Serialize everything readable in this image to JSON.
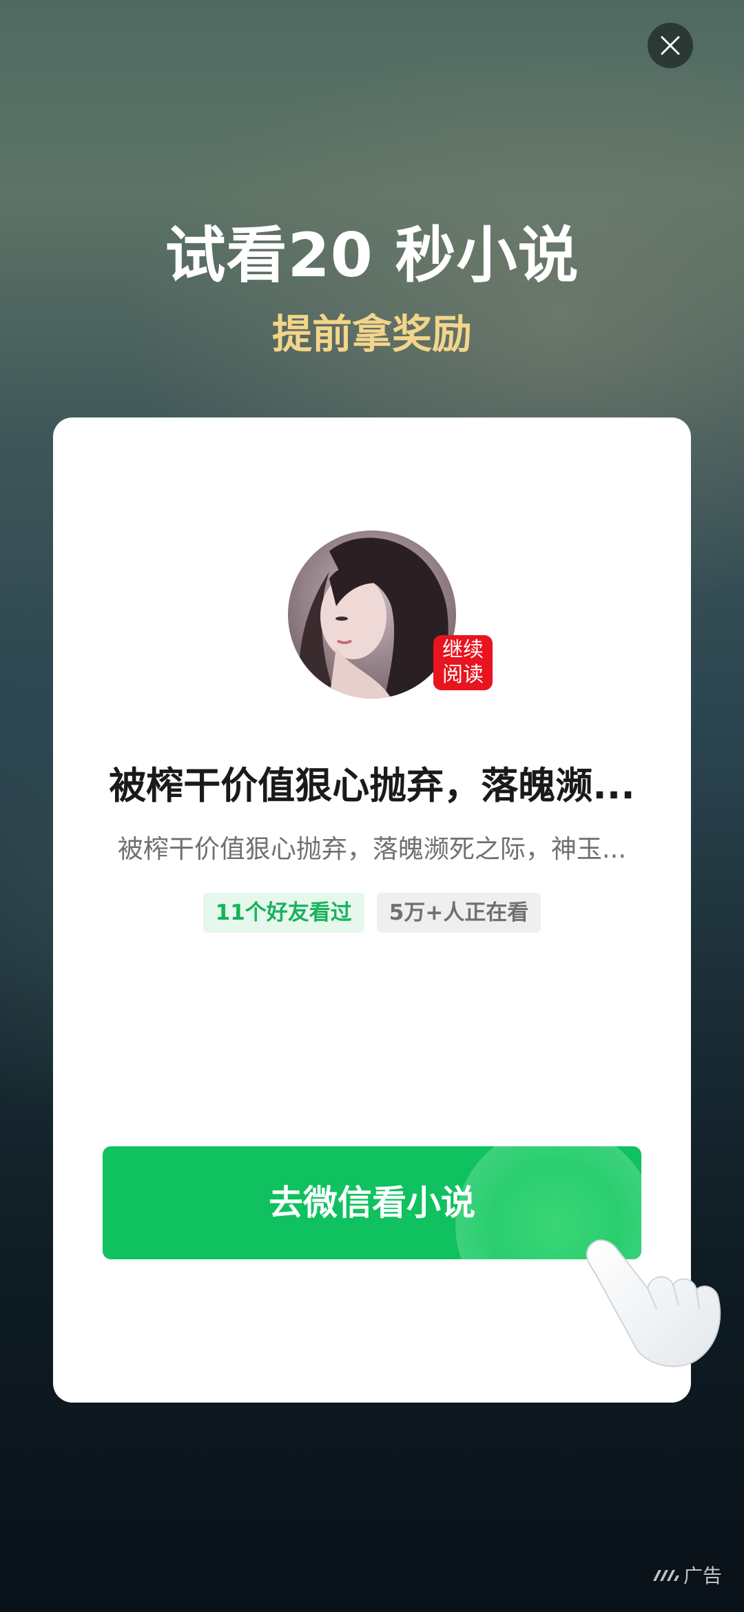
{
  "header": {
    "title": "试看20 秒小说",
    "subtitle": "提前拿奖励"
  },
  "close_button": {
    "icon": "close-icon"
  },
  "book": {
    "cover_badge": [
      "继续",
      "阅读"
    ],
    "title": "被榨干价值狠心抛弃，落魄濒...",
    "description": "被榨干价值狠心抛弃，落魄濒死之际，神玉...",
    "tags": {
      "friends": "11个好友看过",
      "watching": "5万+人正在看"
    }
  },
  "cta": {
    "label": "去微信看小说"
  },
  "footer": {
    "ad_label": "广告",
    "ad_icon": "ad-logo-icon"
  },
  "colors": {
    "accent_green": "#0fc15f",
    "subtitle_gold": "#f3d58a",
    "badge_red": "#e8141f",
    "friends_tag_text": "#17b25c"
  }
}
